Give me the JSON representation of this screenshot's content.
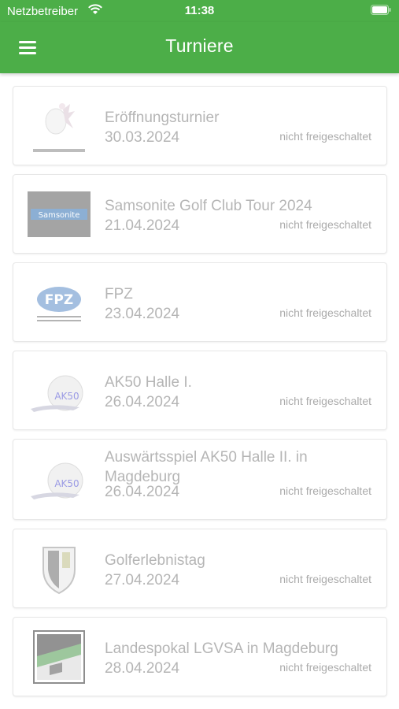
{
  "status_bar": {
    "carrier": "Netzbetreiber",
    "time": "11:38"
  },
  "header": {
    "title": "Turniere"
  },
  "colors": {
    "accent": "#4cae48"
  },
  "tournaments": [
    {
      "name": "Eröffnungsturnier",
      "date": "30.03.2024",
      "status": "nicht freigeschaltet",
      "logo": "egg-tee-logo"
    },
    {
      "name": "Samsonite Golf Club Tour 2024",
      "date": "21.04.2024",
      "status": "nicht freigeschaltet",
      "logo": "samsonite-logo",
      "logo_text": "Samsonite"
    },
    {
      "name": "FPZ",
      "date": "23.04.2024",
      "status": "nicht freigeschaltet",
      "logo": "fpz-logo",
      "logo_text": "FPZ"
    },
    {
      "name": "AK50 Halle I.",
      "date": "26.04.2024",
      "status": "nicht freigeschaltet",
      "logo": "ak50-logo",
      "logo_text": "AK50"
    },
    {
      "name": "Auswärtsspiel AK50 Halle II. in Magdeburg",
      "date": "26.04.2024",
      "status": "nicht freigeschaltet",
      "logo": "ak50-logo",
      "logo_text": "AK50"
    },
    {
      "name": "Golferlebnistag",
      "date": "27.04.2024",
      "status": "nicht freigeschaltet",
      "logo": "golf-club-shield-logo"
    },
    {
      "name": "Landespokal LGVSA in Magdeburg",
      "date": "28.04.2024",
      "status": "nicht freigeschaltet",
      "logo": "saxony-anhalt-crest-logo"
    }
  ]
}
